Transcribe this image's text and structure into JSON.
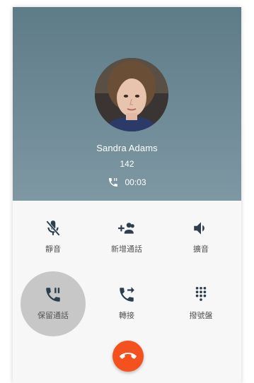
{
  "caller": {
    "name": "Sandra Adams",
    "number": "142",
    "duration": "00:03"
  },
  "controls": [
    {
      "key": "mute",
      "label": "靜音",
      "icon": "mic-off-icon"
    },
    {
      "key": "add_call",
      "label": "新增通話",
      "icon": "add-person-icon"
    },
    {
      "key": "speaker",
      "label": "擴音",
      "icon": "speaker-icon"
    },
    {
      "key": "hold",
      "label": "保留通話",
      "icon": "phone-paused-icon",
      "pressed": true
    },
    {
      "key": "transfer",
      "label": "轉接",
      "icon": "phone-forward-icon"
    },
    {
      "key": "dialpad",
      "label": "撥號盤",
      "icon": "dialpad-icon"
    }
  ],
  "end_call": {
    "icon": "call-end-icon",
    "color": "#f4511e"
  },
  "colors": {
    "header": "#6a8693",
    "accent_icon": "#2d3e4e",
    "label": "#555555",
    "end_call": "#f4511e"
  }
}
